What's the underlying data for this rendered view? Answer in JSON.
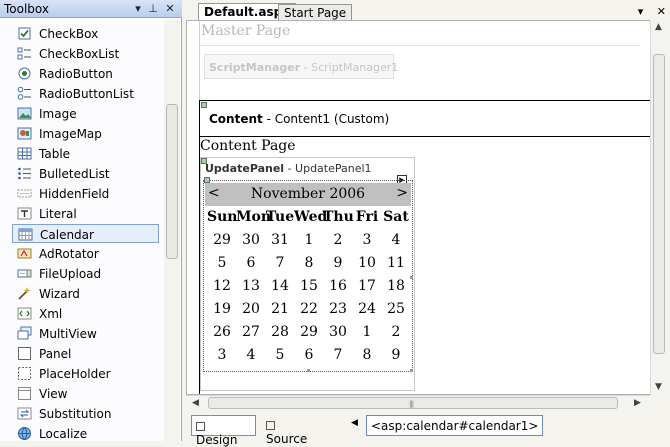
{
  "toolbox": {
    "title": "Toolbox",
    "items": [
      {
        "label": "CheckBox",
        "icon": "checkbox-icon"
      },
      {
        "label": "CheckBoxList",
        "icon": "checkboxlist-icon"
      },
      {
        "label": "RadioButton",
        "icon": "radiobutton-icon"
      },
      {
        "label": "RadioButtonList",
        "icon": "radiobuttonlist-icon"
      },
      {
        "label": "Image",
        "icon": "image-icon"
      },
      {
        "label": "ImageMap",
        "icon": "imagemap-icon"
      },
      {
        "label": "Table",
        "icon": "table-icon"
      },
      {
        "label": "BulletedList",
        "icon": "bulletedlist-icon"
      },
      {
        "label": "HiddenField",
        "icon": "hiddenfield-icon"
      },
      {
        "label": "Literal",
        "icon": "literal-icon"
      },
      {
        "label": "Calendar",
        "icon": "calendar-icon",
        "selected": true
      },
      {
        "label": "AdRotator",
        "icon": "adrotator-icon"
      },
      {
        "label": "FileUpload",
        "icon": "fileupload-icon"
      },
      {
        "label": "Wizard",
        "icon": "wizard-icon"
      },
      {
        "label": "Xml",
        "icon": "xml-icon"
      },
      {
        "label": "MultiView",
        "icon": "multiview-icon"
      },
      {
        "label": "Panel",
        "icon": "panel-icon"
      },
      {
        "label": "PlaceHolder",
        "icon": "placeholder-icon"
      },
      {
        "label": "View",
        "icon": "view-icon"
      },
      {
        "label": "Substitution",
        "icon": "substitution-icon"
      },
      {
        "label": "Localize",
        "icon": "localize-icon"
      }
    ]
  },
  "tabs": [
    {
      "label": "Default.aspx",
      "active": true
    },
    {
      "label": "Start Page",
      "active": false
    }
  ],
  "designer": {
    "master_label": "Master Page",
    "script_manager": {
      "type": "ScriptManager",
      "id": " - ScriptManager1"
    },
    "content": {
      "type": "Content",
      "id": " - Content1 (Custom)"
    },
    "content_page_text": "Content Page",
    "update_panel": {
      "type": "UpdatePanel",
      "id": " - UpdatePanel1"
    },
    "calendar": {
      "prev": "<",
      "next": ">",
      "month": "November 2006",
      "days_of_week": [
        "Sun",
        "Mon",
        "Tue",
        "Wed",
        "Thu",
        "Fri",
        "Sat"
      ],
      "weeks": [
        [
          "29",
          "30",
          "31",
          "1",
          "2",
          "3",
          "4"
        ],
        [
          "5",
          "6",
          "7",
          "8",
          "9",
          "10",
          "11"
        ],
        [
          "12",
          "13",
          "14",
          "15",
          "16",
          "17",
          "18"
        ],
        [
          "19",
          "20",
          "21",
          "22",
          "23",
          "24",
          "25"
        ],
        [
          "26",
          "27",
          "28",
          "29",
          "30",
          "1",
          "2"
        ],
        [
          "3",
          "4",
          "5",
          "6",
          "7",
          "8",
          "9"
        ]
      ]
    }
  },
  "bottom_bar": {
    "design_label": "Design",
    "source_label": "Source",
    "breadcrumb": "<asp:calendar#calendar1>"
  },
  "colors": {
    "selection": "#e6eefb",
    "calendar_title_bg": "#c0c0c0",
    "accent": "#7da2ce"
  }
}
